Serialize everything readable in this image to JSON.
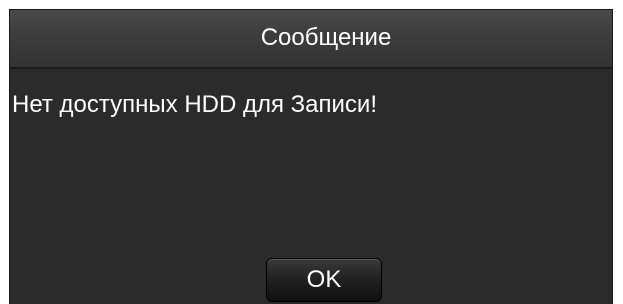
{
  "dialog": {
    "title": "Сообщение",
    "message": "Нет доступных HDD для Записи!",
    "ok_label": "OK"
  }
}
